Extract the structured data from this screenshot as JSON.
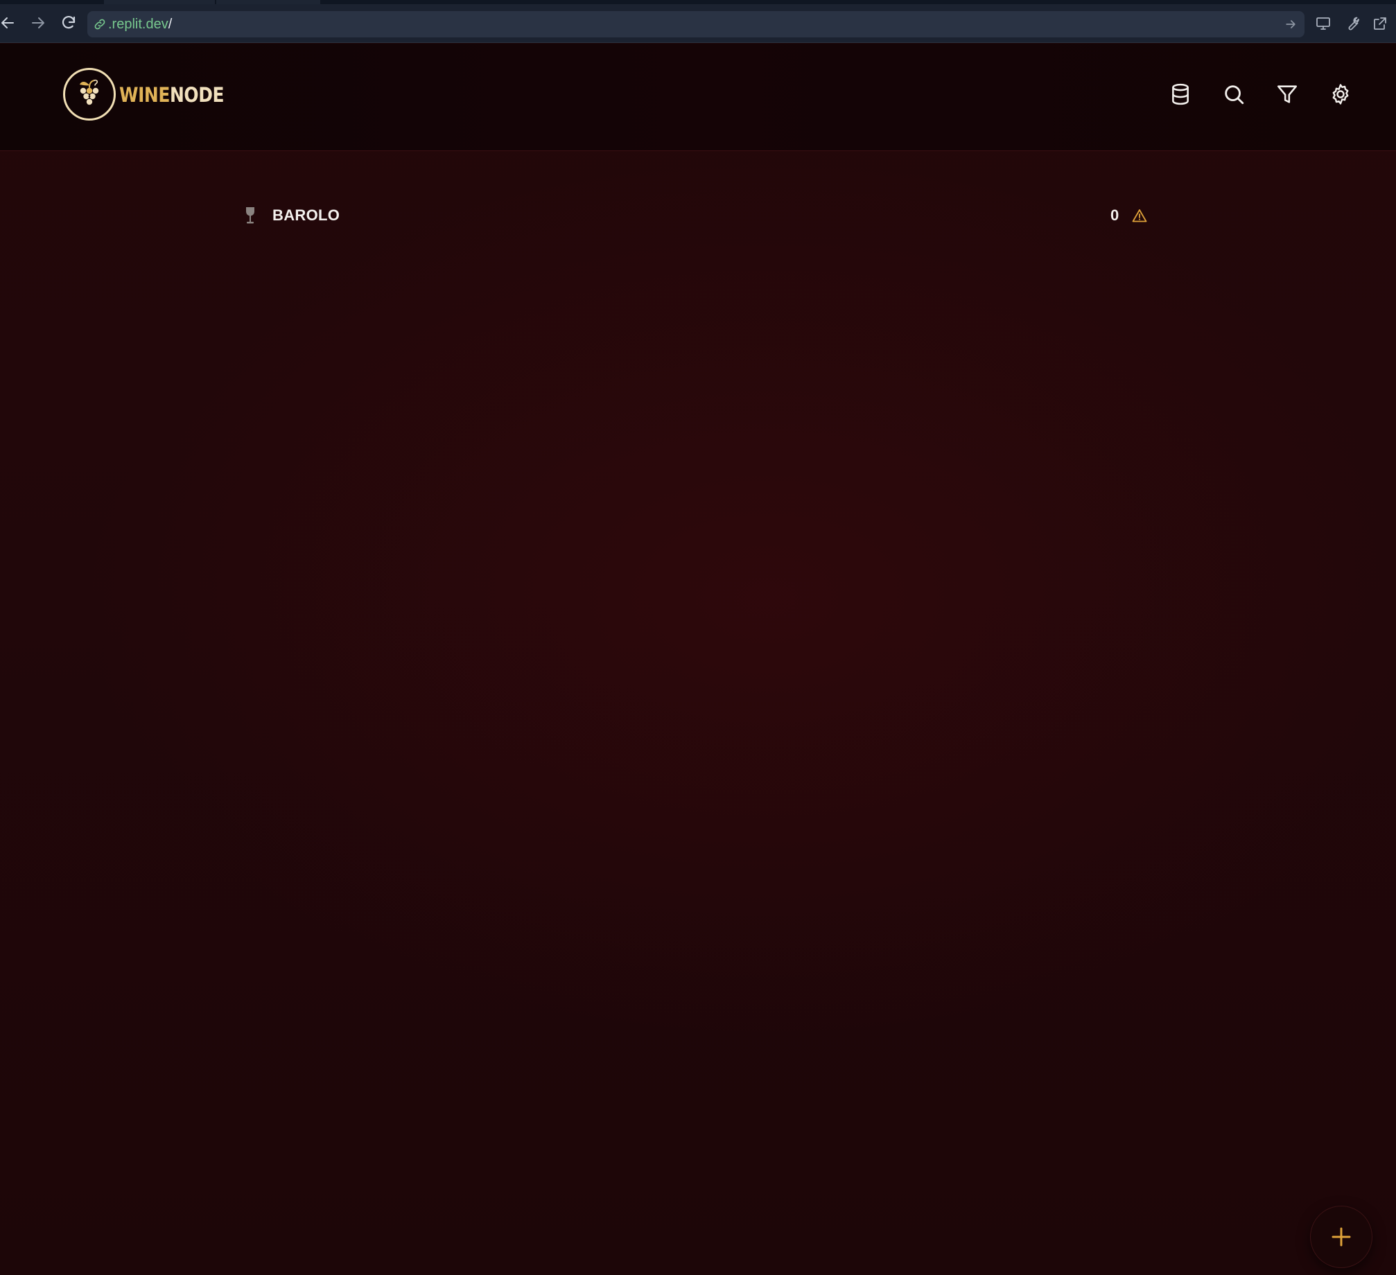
{
  "browser": {
    "url_domain": ".replit.dev",
    "url_path": "/",
    "icons": {
      "back": "arrow-left-icon",
      "forward": "arrow-right-icon",
      "reload": "refresh-icon",
      "link": "link-icon",
      "go": "arrow-right-icon",
      "devtools_preview": "monitor-icon",
      "tools": "wrench-icon",
      "open_external": "external-link-icon"
    }
  },
  "app": {
    "brand_part1": "WINE",
    "brand_part2": "NODE",
    "logo_icon": "grapes-icon",
    "header_icons": [
      "database-icon",
      "search-icon",
      "filter-icon",
      "gear-icon"
    ],
    "colors": {
      "accent_gold": "#e0b357",
      "cream": "#f1e0bd",
      "background": "#21070a",
      "warning": "#e0a33a"
    }
  },
  "wines": [
    {
      "icon": "wine-glass-icon",
      "name": "BAROLO",
      "count": "0",
      "status_icon": "warning-triangle-icon"
    }
  ],
  "fab": {
    "icon": "plus-icon"
  }
}
